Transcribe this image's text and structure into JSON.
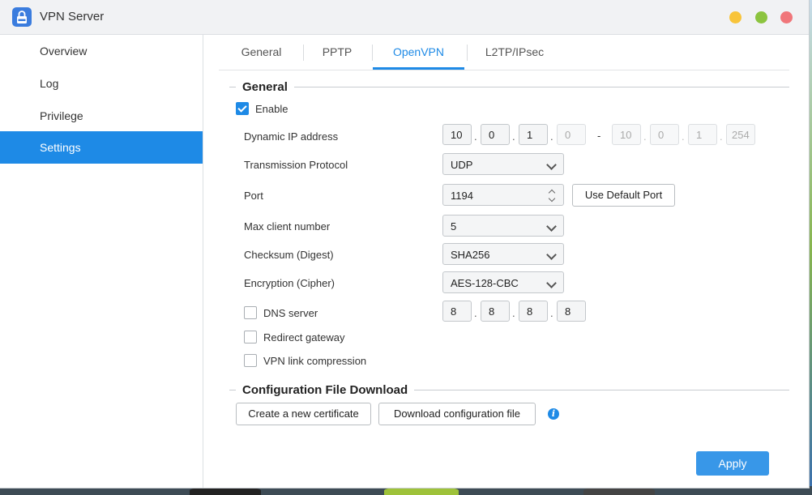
{
  "window": {
    "title": "VPN Server",
    "icon": "lock-icon"
  },
  "sidebar": {
    "items": [
      {
        "label": "Overview",
        "active": false
      },
      {
        "label": "Log",
        "active": false
      },
      {
        "label": "Privilege",
        "active": false
      },
      {
        "label": "Settings",
        "active": true
      }
    ]
  },
  "tabs": [
    {
      "label": "General"
    },
    {
      "label": "PPTP"
    },
    {
      "label": "OpenVPN",
      "active": true
    },
    {
      "label": "L2TP/IPsec"
    }
  ],
  "general": {
    "heading": "General",
    "enable": {
      "label": "Enable",
      "checked": true
    },
    "dynamic_ip": {
      "label": "Dynamic IP address",
      "start": [
        "10",
        "0",
        "1",
        "0"
      ],
      "separator": "-",
      "end": [
        "10",
        "0",
        "1",
        "254"
      ]
    },
    "protocol": {
      "label": "Transmission Protocol",
      "value": "UDP"
    },
    "port": {
      "label": "Port",
      "value": "1194",
      "default_button": "Use Default Port"
    },
    "max_clients": {
      "label": "Max client number",
      "value": "5"
    },
    "checksum": {
      "label": "Checksum (Digest)",
      "value": "SHA256"
    },
    "encryption": {
      "label": "Encryption (Cipher)",
      "value": "AES-128-CBC"
    },
    "dns": {
      "label": "DNS server",
      "checked": false,
      "ip": [
        "8",
        "8",
        "8",
        "8"
      ]
    },
    "redirect_gateway": {
      "label": "Redirect gateway",
      "checked": false
    },
    "compression": {
      "label": "VPN link compression",
      "checked": false
    }
  },
  "config": {
    "heading": "Configuration File Download",
    "create_cert": "Create a new certificate",
    "download": "Download configuration file",
    "info_glyph": "i"
  },
  "apply_label": "Apply",
  "colors": {
    "accent": "#1e8ae6",
    "apply": "#3897e8"
  }
}
